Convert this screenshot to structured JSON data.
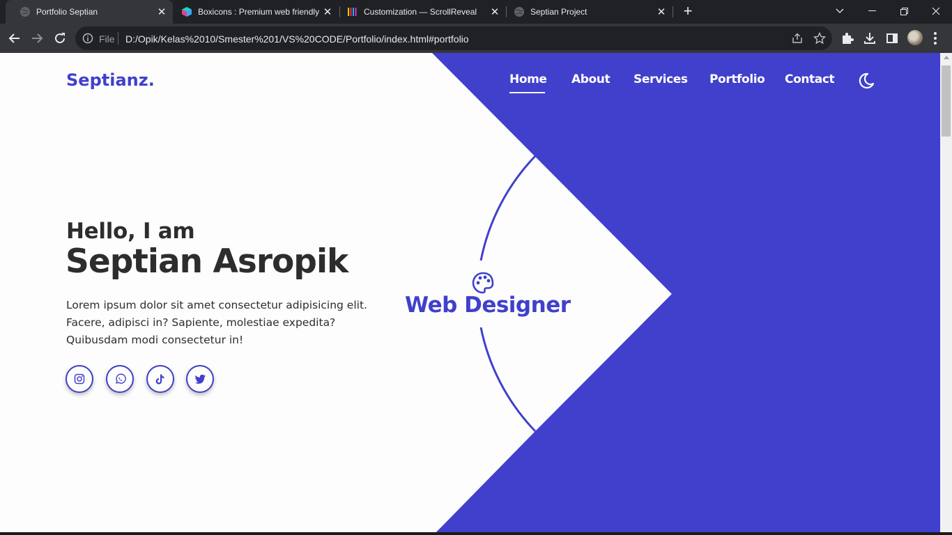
{
  "browser": {
    "tabs": [
      {
        "title": "Portfolio Septian",
        "active": true,
        "favicon": "globe-icon"
      },
      {
        "title": "Boxicons : Premium web friendly icons",
        "active": false,
        "favicon": "boxicons-cube-icon"
      },
      {
        "title": "Customization — ScrollReveal",
        "active": false,
        "favicon": "scrollreveal-bars-icon"
      },
      {
        "title": "Septian Project",
        "active": false,
        "favicon": "globe-icon"
      }
    ],
    "omnibox": {
      "scheme_label": "File",
      "url": "D:/Opik/Kelas%2010/Smester%201/VS%20CODE/Portfolio/index.html#portfolio"
    }
  },
  "page": {
    "logo": "Septianz.",
    "nav": [
      {
        "label": "Home",
        "active": true
      },
      {
        "label": "About",
        "active": false
      },
      {
        "label": "Services",
        "active": false
      },
      {
        "label": "Portfolio",
        "active": false
      },
      {
        "label": "Contact",
        "active": false
      }
    ],
    "theme_toggle_icon": "moon-icon",
    "hero": {
      "greeting": "Hello, I am",
      "name": "Septian Asropik",
      "description": "Lorem ipsum dolor sit amet consectetur adipisicing elit. Facere, adipisci in? Sapiente, molestiae expedita? Quibusdam modi consectetur in!",
      "socials": [
        "instagram-icon",
        "whatsapp-icon",
        "tiktok-icon",
        "twitter-icon"
      ],
      "role": "Web Designer",
      "role_icon": "palette-icon"
    },
    "colors": {
      "accent": "#4040cc",
      "text": "#2d2d2d",
      "background": "#fdfdfd"
    }
  }
}
